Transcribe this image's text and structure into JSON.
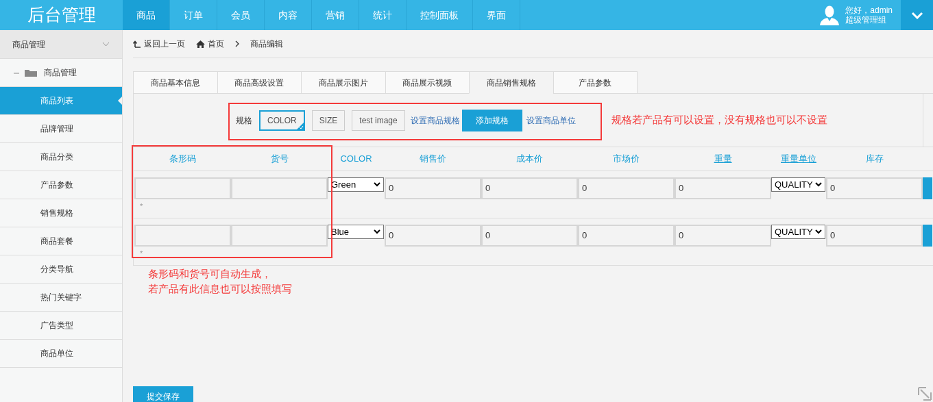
{
  "header": {
    "logo": "后台管理",
    "nav": [
      {
        "label": "商品",
        "selected": true
      },
      {
        "label": "订单",
        "selected": false
      },
      {
        "label": "会员",
        "selected": false
      },
      {
        "label": "内容",
        "selected": false
      },
      {
        "label": "营销",
        "selected": false
      },
      {
        "label": "统计",
        "selected": false
      },
      {
        "label": "控制面板",
        "selected": false
      },
      {
        "label": "界面",
        "selected": false
      }
    ],
    "user": {
      "greeting": "您好，admin",
      "role": "超级管理组"
    }
  },
  "sidebar": {
    "group": {
      "label": "商品管理",
      "expanded": true
    },
    "folder": {
      "label": "商品管理"
    },
    "items": [
      {
        "label": "商品列表",
        "selected": true
      },
      {
        "label": "品牌管理",
        "selected": false
      },
      {
        "label": "商品分类",
        "selected": false
      },
      {
        "label": "产品参数",
        "selected": false
      },
      {
        "label": "销售规格",
        "selected": false
      },
      {
        "label": "商品套餐",
        "selected": false
      },
      {
        "label": "分类导航",
        "selected": false
      },
      {
        "label": "热门关键字",
        "selected": false
      },
      {
        "label": "广告类型",
        "selected": false
      },
      {
        "label": "商品单位",
        "selected": false
      }
    ]
  },
  "breadcrumb": {
    "back": "返回上一页",
    "home": "首页",
    "current": "商品编辑"
  },
  "tabs": [
    {
      "label": "商品基本信息",
      "selected": false
    },
    {
      "label": "商品高级设置",
      "selected": false
    },
    {
      "label": "商品展示图片",
      "selected": false
    },
    {
      "label": "商品展示视频",
      "selected": false
    },
    {
      "label": "商品销售规格",
      "selected": true
    },
    {
      "label": "产品参数",
      "selected": false
    }
  ],
  "spec": {
    "label": "规格",
    "options": [
      {
        "label": "COLOR",
        "selected": true
      },
      {
        "label": "SIZE",
        "selected": false
      },
      {
        "label": "test image",
        "selected": false
      }
    ],
    "set_link": "设置商品规格",
    "add_button": "添加规格",
    "unit_link": "设置商品单位",
    "note": "规格若产品有可以设置，没有规格也可以不设置"
  },
  "table": {
    "columns": [
      {
        "label": "条形码",
        "underlined": false
      },
      {
        "label": "货号",
        "underlined": false
      },
      {
        "label": "COLOR",
        "underlined": false
      },
      {
        "label": "销售价",
        "underlined": false
      },
      {
        "label": "成本价",
        "underlined": false
      },
      {
        "label": "市场价",
        "underlined": false
      },
      {
        "label": "重量",
        "underlined": true
      },
      {
        "label": "重量单位",
        "underlined": true
      },
      {
        "label": "库存",
        "underlined": false
      }
    ],
    "rows": [
      {
        "option": "Green",
        "sale_price": "0",
        "cost_price": "0",
        "market_price": "0",
        "weight": "0",
        "unit": "QUALITY",
        "stock": "0",
        "mark": "*"
      },
      {
        "option": "Blue",
        "sale_price": "0",
        "cost_price": "0",
        "market_price": "0",
        "weight": "0",
        "unit": "QUALITY",
        "stock": "0",
        "mark": "*"
      }
    ]
  },
  "table_note": [
    "条形码和货号可自动生成，",
    "若产品有此信息也可以按照填写"
  ],
  "submit": "提交保存"
}
